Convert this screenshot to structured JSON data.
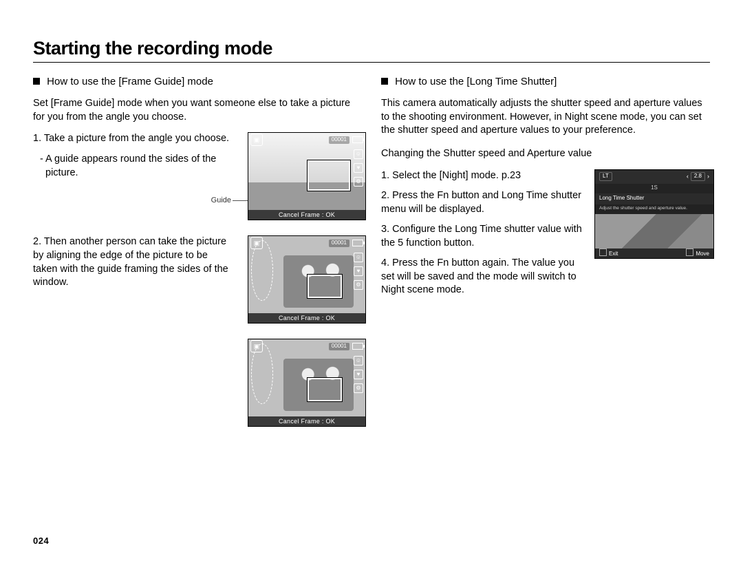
{
  "page": {
    "title": "Starting the recording mode",
    "number": "024"
  },
  "left": {
    "heading": "How to use the [Frame Guide] mode",
    "intro": "Set [Frame Guide] mode when you want someone else to take a picture for you from the angle you choose.",
    "step1": "1. Take a picture from the angle you choose.",
    "step1_sub": "- A guide appears round the sides of the picture.",
    "guide_label": "Guide",
    "step2": "2. Then another person can take the picture by aligning the edge of the picture to be taken with the guide framing the sides of the window.",
    "lcd": {
      "bottom_text": "Cancel Frame : OK",
      "counter": "00001"
    }
  },
  "right": {
    "heading": "How to use the [Long Time Shutter]",
    "intro": "This camera automatically adjusts the shutter speed and aperture values to the shooting environment. However, in Night scene mode, you can set the shutter speed and aperture values to your preference.",
    "sub_heading": "Changing the Shutter speed and Aperture value",
    "step1": "1.  Select the [Night] mode.  p.23",
    "step2": "2. Press the Fn button and Long Time shutter menu will be displayed.",
    "step3": "3. Configure the Long Time shutter value with the 5 function button.",
    "step4": "4. Press the Fn button again. The value you set will be saved and the mode will switch to Night scene mode.",
    "lt_screen": {
      "badge": "LT",
      "aperture": "2.8",
      "shutter": "1S",
      "menu_label": "Long Time Shutter",
      "hint": "Adjust the shutter speed and aperture value.",
      "exit": "Exit",
      "move": "Move"
    }
  }
}
